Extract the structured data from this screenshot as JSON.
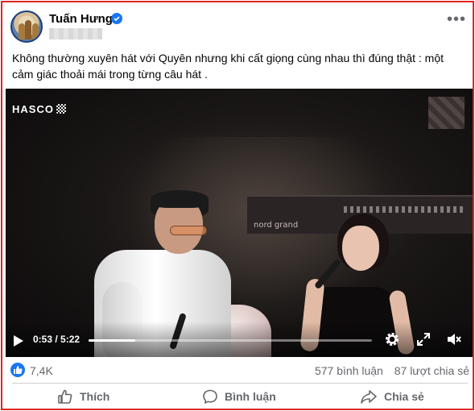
{
  "post": {
    "author": "Tuấn Hưng",
    "caption": "Không thường xuyên hát với Quyên nhưng khi cất giọng cùng nhau thì đúng thật : một cảm giác thoải mái trong từng câu hát ."
  },
  "video": {
    "overlay_logo": "HASCO",
    "keyboard_brand": "nord grand",
    "current_time": "0:53",
    "duration": "5:22",
    "time_display": "0:53 / 5:22",
    "progress_fraction": 0.165
  },
  "stats": {
    "reactions_count": "7,4K",
    "comments": "577 bình luận",
    "shares": "87 lượt chia sẻ"
  },
  "actions": {
    "like_label": "Thích",
    "comment_label": "Bình luận",
    "share_label": "Chia sẻ"
  },
  "icons": [
    "verified-icon",
    "more-options-icon",
    "play-icon",
    "settings-icon",
    "fullscreen-icon",
    "mute-icon",
    "like-reaction-icon",
    "thumbs-up-icon",
    "comment-icon",
    "share-icon"
  ],
  "colors": {
    "accent": "#1877f2",
    "frame_border": "#e02424",
    "secondary_text": "#65676b"
  }
}
